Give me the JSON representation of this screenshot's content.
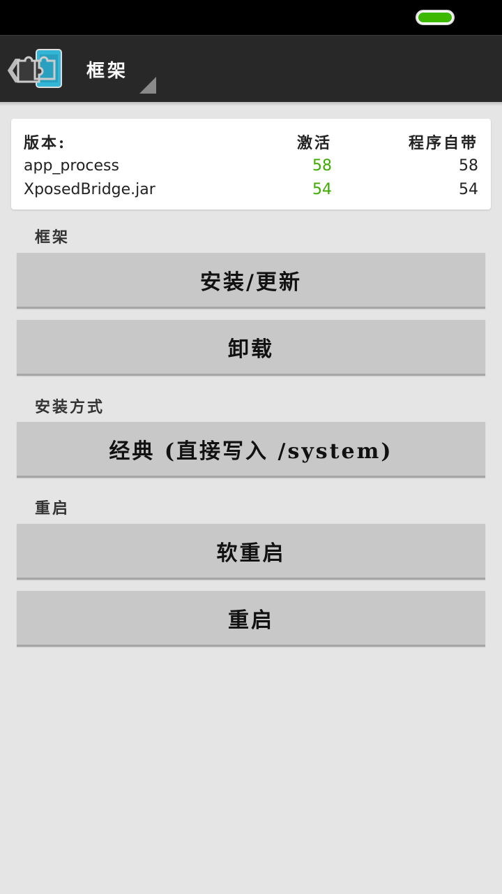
{
  "status_bar": {
    "battery_color": "#3cb800"
  },
  "action_bar": {
    "title": "框架",
    "back_icon": "chevron-left-icon",
    "logo_icon": "xposed-puzzle-phone-icon"
  },
  "version_table": {
    "headers": {
      "name": "版本:",
      "active": "激活",
      "bundled": "程序自带"
    },
    "rows": [
      {
        "name": "app_process",
        "active": "58",
        "bundled": "58"
      },
      {
        "name": "XposedBridge.jar",
        "active": "54",
        "bundled": "54"
      }
    ],
    "active_color": "#3cab00"
  },
  "sections": {
    "framework": {
      "label": "框架",
      "install_update": "安装/更新",
      "uninstall": "卸载"
    },
    "install_method": {
      "label": "安装方式",
      "classic": "经典 (直接写入 /system)"
    },
    "reboot": {
      "label": "重启",
      "soft_reboot": "软重启",
      "reboot": "重启"
    }
  }
}
